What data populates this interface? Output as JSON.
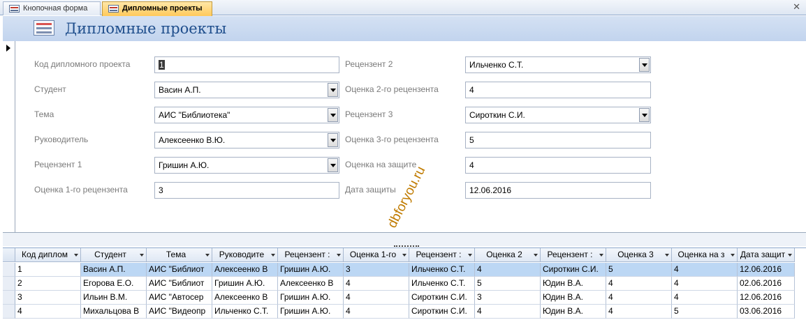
{
  "tabs": [
    {
      "label": "Кнопочная форма"
    },
    {
      "label": "Дипломные проекты"
    }
  ],
  "form": {
    "title": "Дипломные проекты",
    "fields": {
      "code": {
        "label": "Код дипломного проекта",
        "value": "1"
      },
      "student": {
        "label": "Студент",
        "value": "Васин А.П."
      },
      "topic": {
        "label": "Тема",
        "value": "АИС \"Библиотека\""
      },
      "supervisor": {
        "label": "Руководитель",
        "value": "Алексеенко В.Ю."
      },
      "reviewer1": {
        "label": "Рецензент 1",
        "value": "Гришин А.Ю."
      },
      "grade1": {
        "label": "Оценка 1-го рецензента",
        "value": "3"
      },
      "reviewer2": {
        "label": "Рецензент 2",
        "value": "Ильченко С.Т."
      },
      "grade2": {
        "label": "Оценка 2-го рецензента",
        "value": "4"
      },
      "reviewer3": {
        "label": "Рецензент 3",
        "value": "Сироткин С.И."
      },
      "grade3": {
        "label": "Оценка 3-го рецензента",
        "value": "5"
      },
      "defense_grade": {
        "label": "Оценка на защите",
        "value": "4"
      },
      "defense_date": {
        "label": "Дата защиты",
        "value": "12.06.2016"
      }
    },
    "watermark": "dbforyou.ru"
  },
  "grid": {
    "columns": [
      "Код диплом",
      "Студент",
      "Тема",
      "Руководите",
      "Рецензент :",
      "Оценка 1-го",
      "Рецензент :",
      "Оценка 2",
      "Рецензент :",
      "Оценка 3",
      "Оценка на з",
      "Дата защит"
    ],
    "rows": [
      [
        "1",
        "Васин А.П.",
        "АИС \"Библиот",
        "Алексеенко В",
        "Гришин А.Ю.",
        "3",
        "Ильченко С.Т.",
        "4",
        "Сироткин С.И.",
        "5",
        "4",
        "12.06.2016"
      ],
      [
        "2",
        "Егорова Е.О.",
        "АИС \"Библиот",
        "Гришин А.Ю.",
        "Алексеенко В",
        "4",
        "Ильченко С.Т.",
        "5",
        "Юдин В.А.",
        "4",
        "4",
        "02.06.2016"
      ],
      [
        "3",
        "Ильин В.М.",
        "АИС \"Автосер",
        "Алексеенко В",
        "Гришин А.Ю.",
        "4",
        "Сироткин С.И.",
        "3",
        "Юдин В.А.",
        "4",
        "4",
        "12.06.2016"
      ],
      [
        "4",
        "Михальцова В",
        "АИС \"Видеопр",
        "Ильченко С.Т.",
        "Гришин А.Ю.",
        "4",
        "Сироткин С.И.",
        "4",
        "Юдин В.А.",
        "4",
        "5",
        "03.06.2016"
      ]
    ]
  }
}
